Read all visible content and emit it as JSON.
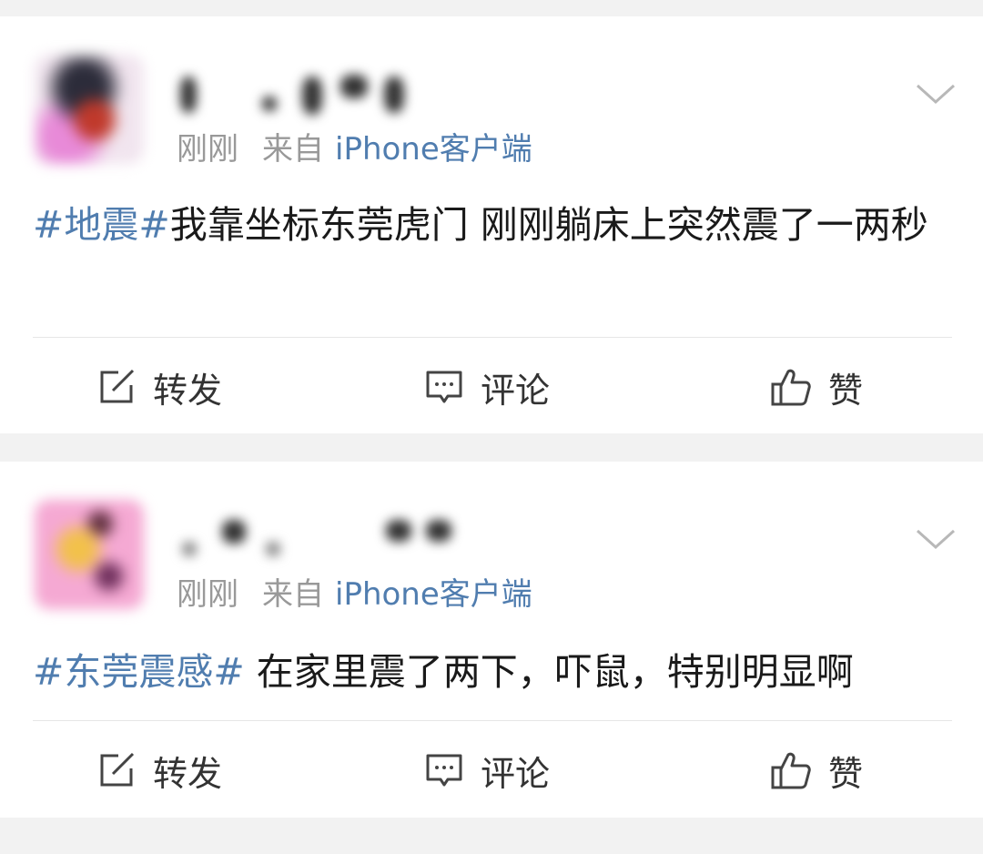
{
  "posts": [
    {
      "time": "刚刚",
      "source_prefix": "来自",
      "client": "iPhone客户端",
      "topic": "#地震#",
      "text": "我靠坐标东莞虎门 刚刚躺床上突然震了一两秒",
      "actions": {
        "repost": "转发",
        "comment": "评论",
        "like": "赞"
      }
    },
    {
      "time": "刚刚",
      "source_prefix": "来自",
      "client": "iPhone客户端",
      "topic": "#东莞震感#",
      "text": " 在家里震了两下，吓鼠，特别明显啊",
      "actions": {
        "repost": "转发",
        "comment": "评论",
        "like": "赞"
      }
    }
  ],
  "icons": {
    "repost": "edit-square-icon",
    "comment": "comment-bubble-icon",
    "like": "thumbs-up-icon",
    "menu": "chevron-down-icon"
  },
  "colors": {
    "link": "#507daf",
    "meta": "#999999",
    "text": "#1a1a1a",
    "background": "#f2f2f2"
  }
}
